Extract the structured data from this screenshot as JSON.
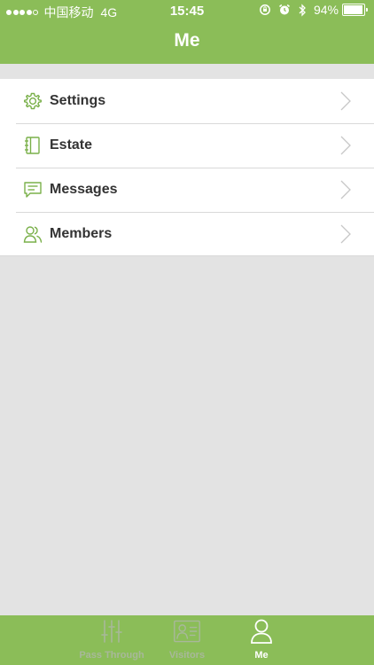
{
  "status_bar": {
    "carrier": "中国移动",
    "network": "4G",
    "time": "15:45",
    "battery": "94%",
    "icons": [
      "signal-dots",
      "rotation-lock-icon",
      "alarm-icon",
      "bluetooth-icon",
      "battery-icon"
    ]
  },
  "header": {
    "title": "Me"
  },
  "menu": {
    "items": [
      {
        "label": "Settings",
        "icon": "gear-icon"
      },
      {
        "label": "Estate",
        "icon": "notebook-icon"
      },
      {
        "label": "Messages",
        "icon": "message-icon"
      },
      {
        "label": "Members",
        "icon": "members-icon"
      }
    ]
  },
  "tabbar": {
    "tabs": [
      {
        "label": "Pass Through",
        "icon": "sliders-icon",
        "active": false
      },
      {
        "label": "Visitors",
        "icon": "id-card-icon",
        "active": false
      },
      {
        "label": "Me",
        "icon": "person-icon",
        "active": true
      }
    ]
  },
  "colors": {
    "brand_green": "#8bbd58",
    "background": "#e3e3e3",
    "list_bg": "#ffffff",
    "label_text": "#333333",
    "tab_inactive": "#a8b89a"
  }
}
